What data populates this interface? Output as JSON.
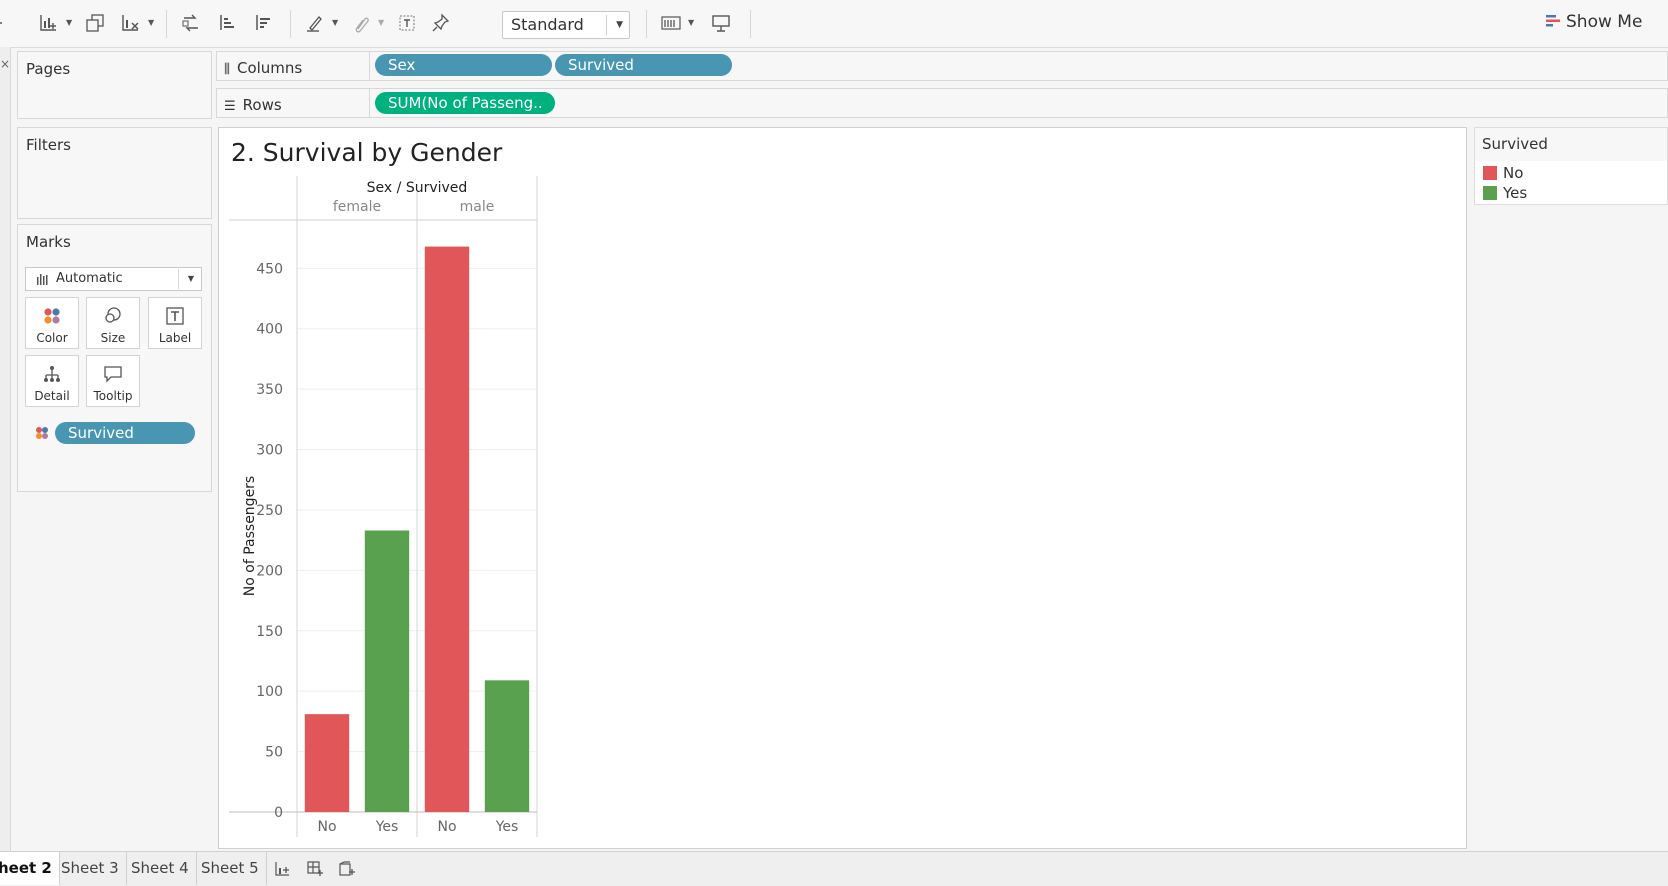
{
  "toolbar": {
    "fit_value": "Standard",
    "show_me_label": "Show Me"
  },
  "cards": {
    "pages_title": "Pages",
    "filters_title": "Filters",
    "marks_title": "Marks",
    "mark_type": "Automatic",
    "mark_buttons": [
      "Color",
      "Size",
      "Label",
      "Detail",
      "Tooltip"
    ],
    "color_pill": "Survived"
  },
  "shelves": {
    "columns_label": "Columns",
    "rows_label": "Rows",
    "columns_pills": [
      "Sex",
      "Survived"
    ],
    "rows_pills": [
      "SUM(No of Passeng.."
    ]
  },
  "view": {
    "title": "2. Survival by Gender"
  },
  "legend": {
    "title": "Survived",
    "items": [
      {
        "label": "No",
        "color": "#e15759"
      },
      {
        "label": "Yes",
        "color": "#59a14f"
      }
    ]
  },
  "tabs": {
    "sheets": [
      "heet 2",
      "Sheet 3",
      "Sheet 4",
      "Sheet 5"
    ],
    "active": 0
  },
  "chart_data": {
    "type": "bar",
    "title": "2. Survival by Gender",
    "header_title": "Sex / Survived",
    "groups": [
      "female",
      "male"
    ],
    "categories": [
      "No",
      "Yes",
      "No",
      "Yes"
    ],
    "category_groups": [
      "female",
      "female",
      "male",
      "male"
    ],
    "values": [
      81,
      233,
      468,
      109
    ],
    "colors": [
      "#e15759",
      "#59a14f",
      "#e15759",
      "#59a14f"
    ],
    "ylabel": "No of Passengers",
    "yticks": [
      0,
      50,
      100,
      150,
      200,
      250,
      300,
      350,
      400,
      450
    ],
    "ylim": [
      0,
      490
    ],
    "grid": true
  }
}
